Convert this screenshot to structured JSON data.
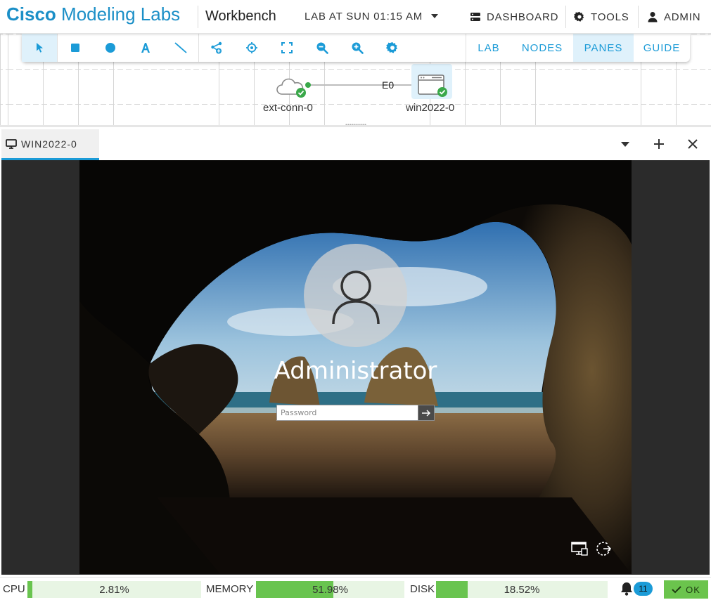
{
  "header": {
    "brand_bold": "Cisco",
    "brand_rest": " Modeling Labs",
    "workbench": "Workbench",
    "lab_title": "LAB AT SUN 01:15 AM",
    "dashboard": "DASHBOARD",
    "tools": "TOOLS",
    "admin": "ADMIN"
  },
  "toolbar": {
    "tools": [
      "select",
      "rectangle",
      "ellipse",
      "text",
      "line",
      "add-node",
      "center",
      "fit",
      "zoom-out",
      "zoom-in",
      "settings"
    ],
    "tabs": [
      "LAB",
      "NODES",
      "PANES",
      "GUIDE"
    ],
    "active_tab": "PANES"
  },
  "topology": {
    "nodes": [
      {
        "name": "ext-conn-0",
        "icon": "cloud-icon",
        "state": "booted"
      },
      {
        "name": "win2022-0",
        "icon": "server-window-icon",
        "state": "booted"
      }
    ],
    "link_interface": "E0"
  },
  "pane": {
    "tab_label": "WIN2022-0"
  },
  "console": {
    "user_name": "Administrator",
    "password_placeholder": "Password"
  },
  "status": {
    "cpu_label": "CPU",
    "cpu_value": "2.81%",
    "cpu_fraction": 0.0281,
    "memory_label": "MEMORY",
    "memory_value": "51.98%",
    "memory_fraction": 0.5198,
    "disk_label": "DISK",
    "disk_value": "18.52%",
    "disk_fraction": 0.1852,
    "notifications": "11",
    "ok_label": "OK"
  },
  "colors": {
    "brand": "#1b8fc7",
    "accent": "#1b9bd7",
    "ok_green": "#3aa84a",
    "meter_fill": "#69c44f"
  }
}
